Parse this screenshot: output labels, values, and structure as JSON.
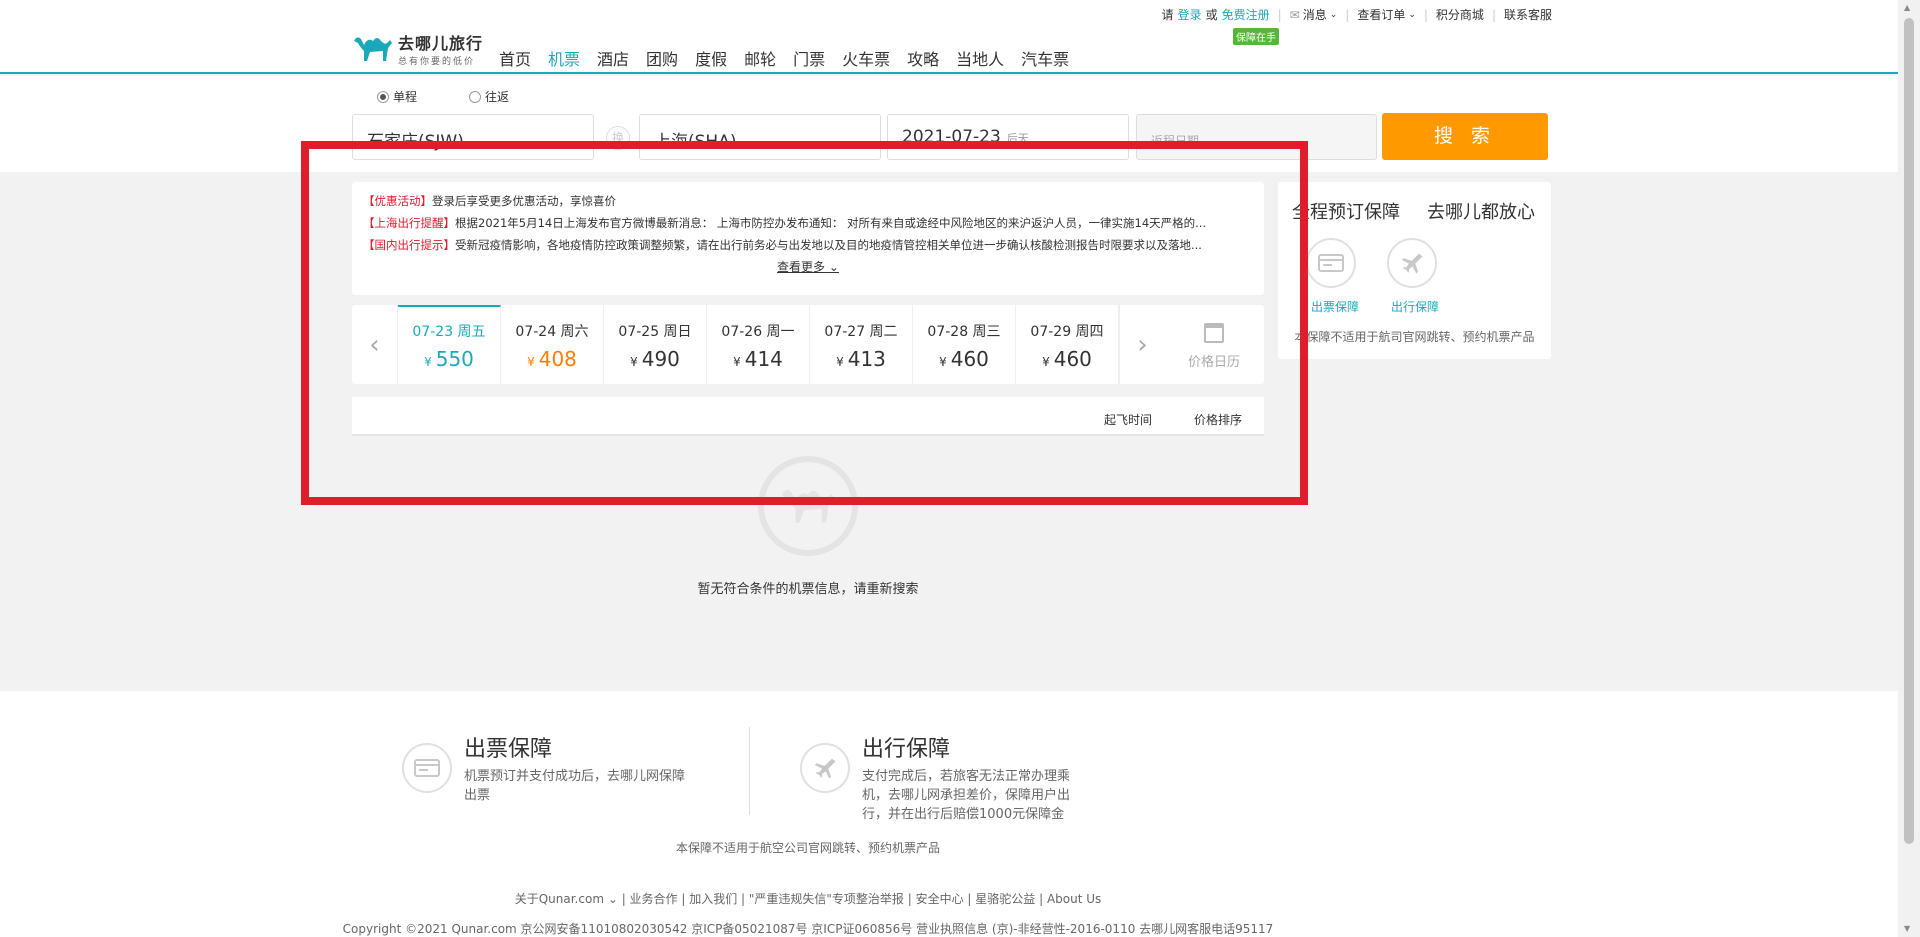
{
  "topbar": {
    "prefix": "请",
    "login": "登录",
    "or": "或",
    "register": "免费注册",
    "messages": "消息",
    "orders": "查看订单",
    "points": "积分商城",
    "service": "联系客服",
    "badge": "保障在手"
  },
  "logo": {
    "name": "去哪儿旅行",
    "slogan": "总有你要的低价"
  },
  "nav": [
    "首页",
    "机票",
    "酒店",
    "团购",
    "度假",
    "邮轮",
    "门票",
    "火车票",
    "攻略",
    "当地人",
    "汽车票"
  ],
  "search": {
    "oneway": "单程",
    "roundtrip": "往返",
    "from": "石家庄(SJW)",
    "swap": "换",
    "to": "上海(SHA)",
    "date": "2021-07-23",
    "date_sub": "后天",
    "return_placeholder": "返程日期",
    "button": "搜 索"
  },
  "notice": {
    "items": [
      {
        "tag": "【优惠活动】",
        "text": "登录后享受更多优惠活动，享惊喜价"
      },
      {
        "tag": "【上海出行提醒】",
        "text": "根据2021年5月14日上海发布官方微博最新消息： 上海市防控办发布通知： 对所有来自或途经中风险地区的来沪返沪人员，一律实施14天严格的..."
      },
      {
        "tag": "【国内出行提示】",
        "text": "受新冠疫情影响，各地疫情防控政策调整频繁，请在出行前务必与出发地以及目的地疫情管控相关单位进一步确认核酸检测报告时限要求以及落地..."
      }
    ],
    "more": "查看更多"
  },
  "dates": [
    {
      "date": "07-23 周五",
      "price": "550"
    },
    {
      "date": "07-24 周六",
      "price": "408"
    },
    {
      "date": "07-25 周日",
      "price": "490"
    },
    {
      "date": "07-26 周一",
      "price": "414"
    },
    {
      "date": "07-27 周二",
      "price": "413"
    },
    {
      "date": "07-28 周三",
      "price": "460"
    },
    {
      "date": "07-29 周四",
      "price": "460"
    }
  ],
  "currency": "¥",
  "calendar": "价格日历",
  "sort": {
    "time": "起飞时间",
    "price": "价格排序"
  },
  "empty": "暂无符合条件的机票信息，请重新搜索",
  "side": {
    "title1": "全程预订保障",
    "title2": "去哪儿都放心",
    "ticket": "出票保障",
    "travel": "出行保障",
    "note": "本保障不适用于航司官网跳转、预约机票产品"
  },
  "footer": {
    "ticket_title": "出票保障",
    "ticket_desc": "机票预订并支付成功后，去哪儿网保障出票",
    "travel_title": "出行保障",
    "travel_desc": "支付完成后，若旅客无法正常办理乘机，去哪儿网承担差价，保障用户出行，并在出行后赔偿1000元保障金",
    "note": "本保障不适用于航空公司官网跳转、预约机票产品",
    "links": "关于Qunar.com ⌄ | 业务合作 | 加入我们 | \"严重违规失信\"专项整治举报 | 安全中心 | 星骆驼公益 | About Us",
    "copyright": "Copyright ©2021 Qunar.com  京公网安备11010802030542  京ICP备05021087号  京ICP证060856号  营业执照信息  (京)-非经营性-2016-0110  去哪儿网客服电话95117"
  },
  "colors": {
    "accent": "#1ba9ba",
    "orange": "#ff9900",
    "highlight": "#e01e2b",
    "low_price": "#ff7e00"
  }
}
